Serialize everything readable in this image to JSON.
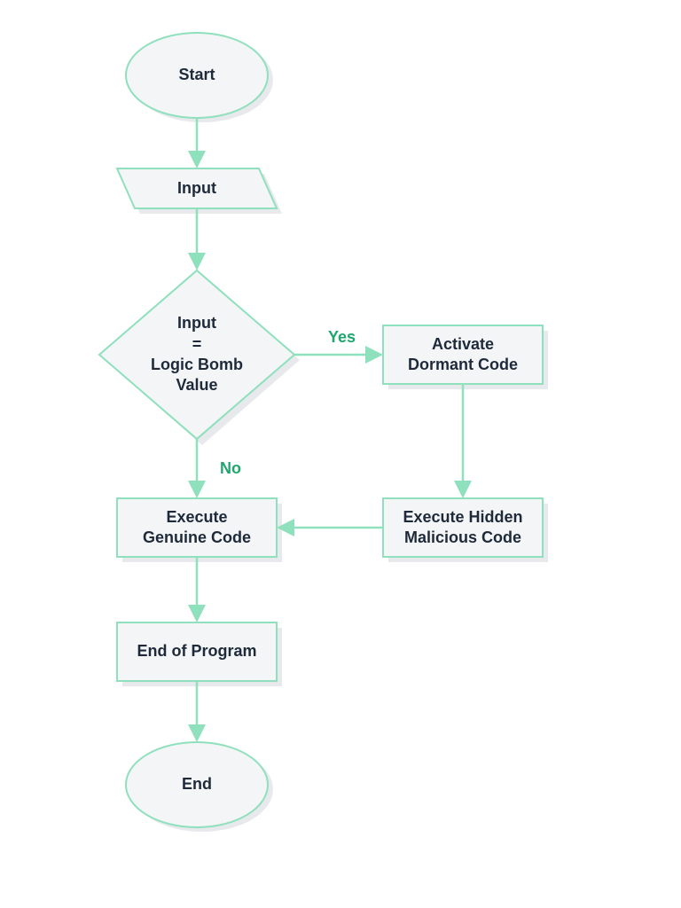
{
  "nodes": {
    "start": "Start",
    "input": "Input",
    "decision": "Input\n=\nLogic Bomb\nValue",
    "activate": "Activate\nDormant Code",
    "genuine": "Execute\nGenuine Code",
    "hidden": "Execute Hidden\nMalicious Code",
    "endprog": "End of Program",
    "end": "End"
  },
  "edges": {
    "yes": "Yes",
    "no": "No"
  },
  "colors": {
    "stroke": "#8fe0bd",
    "fill": "#f4f5f7",
    "shadow": "#e8e9ec",
    "text": "#1e2a3a",
    "edgeText": "#1ea76d"
  },
  "chart_data": {
    "type": "flowchart",
    "title": "Logic Bomb program flow",
    "nodes": [
      {
        "id": "start",
        "shape": "terminator",
        "label": "Start"
      },
      {
        "id": "input",
        "shape": "io",
        "label": "Input"
      },
      {
        "id": "decision",
        "shape": "decision",
        "label": "Input = Logic Bomb Value"
      },
      {
        "id": "activate",
        "shape": "process",
        "label": "Activate Dormant Code"
      },
      {
        "id": "hidden",
        "shape": "process",
        "label": "Execute Hidden Malicious Code"
      },
      {
        "id": "genuine",
        "shape": "process",
        "label": "Execute Genuine Code"
      },
      {
        "id": "endprog",
        "shape": "process",
        "label": "End of Program"
      },
      {
        "id": "end",
        "shape": "terminator",
        "label": "End"
      }
    ],
    "edges": [
      {
        "from": "start",
        "to": "input"
      },
      {
        "from": "input",
        "to": "decision"
      },
      {
        "from": "decision",
        "to": "activate",
        "label": "Yes"
      },
      {
        "from": "decision",
        "to": "genuine",
        "label": "No"
      },
      {
        "from": "activate",
        "to": "hidden"
      },
      {
        "from": "hidden",
        "to": "genuine"
      },
      {
        "from": "genuine",
        "to": "endprog"
      },
      {
        "from": "endprog",
        "to": "end"
      }
    ]
  }
}
